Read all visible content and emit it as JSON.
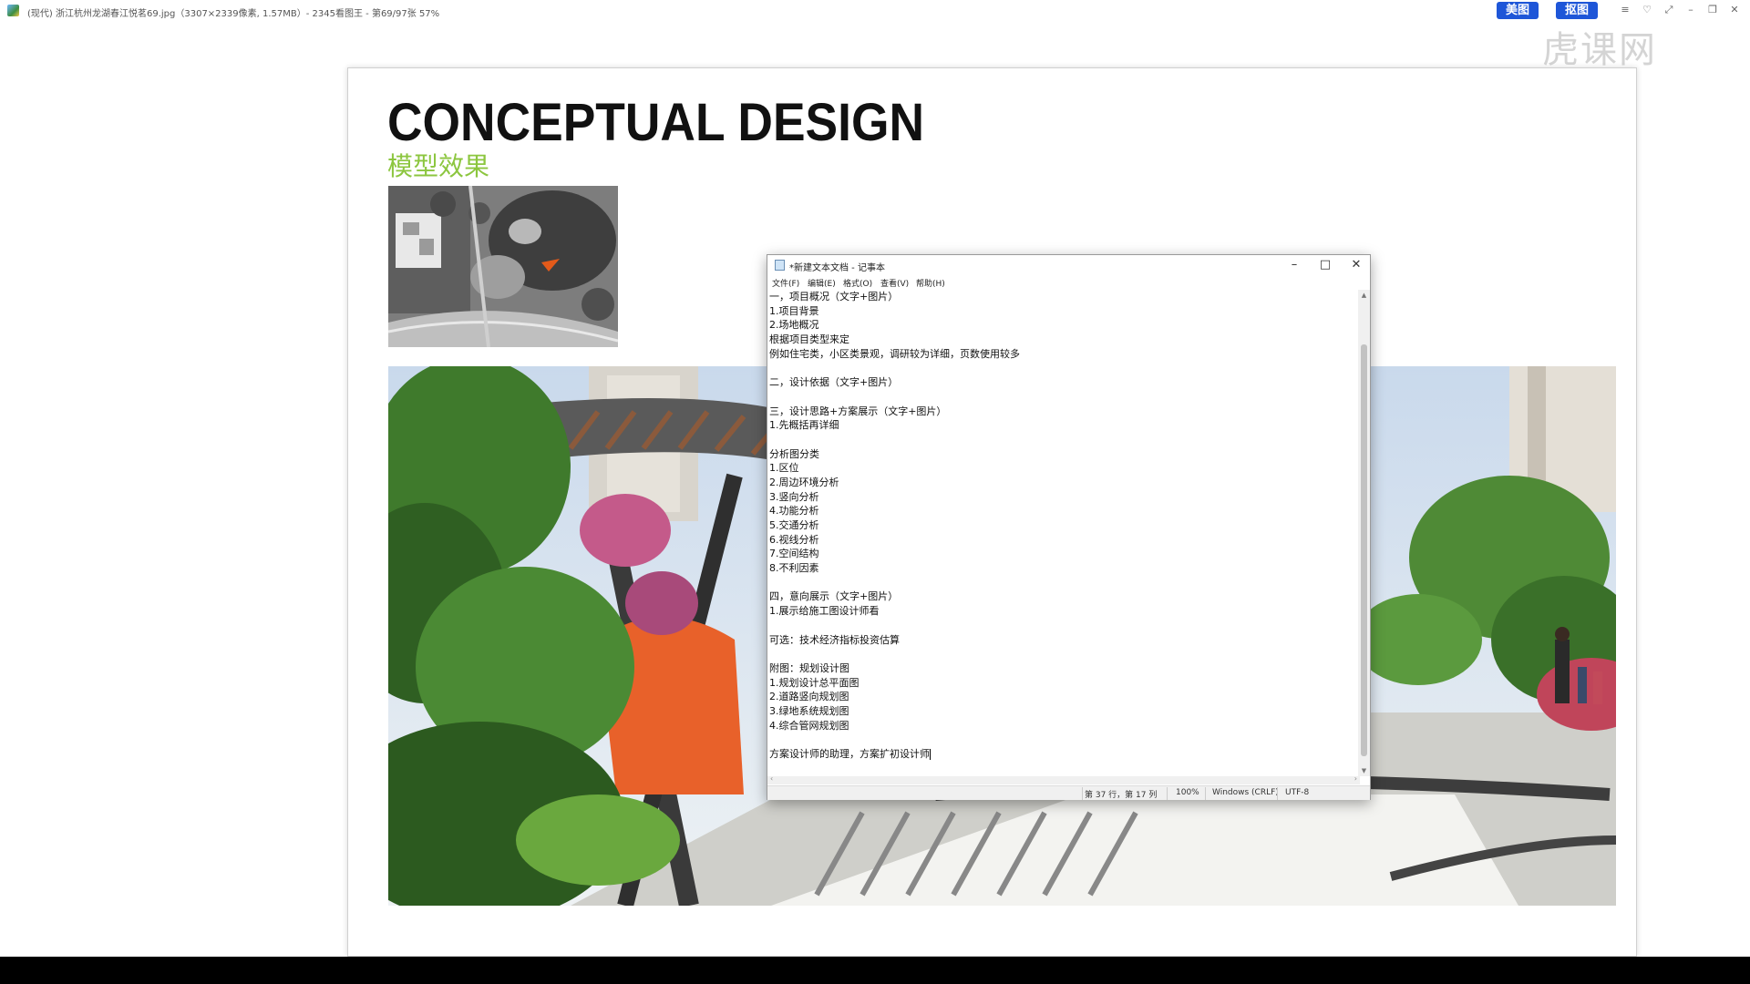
{
  "viewer": {
    "title": "(现代) 浙江杭州龙湖春江悦茗69.jpg（3307×2339像素, 1.57MB）- 2345看图王 - 第69/97张 57%",
    "btn_meitu": "美图",
    "btn_koutu": "抠图",
    "watermark": "虎课网",
    "controls": [
      "≡",
      "♡",
      "⤢",
      "–",
      "❐",
      "✕"
    ]
  },
  "document": {
    "title": "CONCEPTUAL DESIGN",
    "subtitle": "模型效果"
  },
  "notepad": {
    "title": "*新建文本文档 - 记事本",
    "controls": {
      "minimize": "–",
      "maximize": "□",
      "close": "✕"
    },
    "menu": [
      "文件(F)",
      "编辑(E)",
      "格式(O)",
      "查看(V)",
      "帮助(H)"
    ],
    "lines": [
      "一，项目概况（文字+图片）",
      "1.项目背景",
      "2.场地概况",
      "根据项目类型来定",
      "例如住宅类，小区类景观，调研较为详细，页数使用较多",
      "",
      "二，设计依据（文字+图片）",
      "",
      "三，设计思路+方案展示（文字+图片）",
      "1.先概括再详细",
      "",
      "分析图分类",
      "1.区位",
      "2.周边环境分析",
      "3.竖向分析",
      "4.功能分析",
      "5.交通分析",
      "6.视线分析",
      "7.空间结构",
      "8.不利因素",
      "",
      "四，意向展示（文字+图片）",
      "1.展示给施工图设计师看",
      "",
      "可选：技术经济指标投资估算",
      "",
      "附图：规划设计图",
      "1.规划设计总平面图",
      "2.道路竖向规划图",
      "3.绿地系统规划图",
      "4.综合管网规划图",
      "",
      "方案设计师的助理，方案扩初设计师"
    ],
    "status": {
      "position": "第 37 行，第 17 列",
      "zoom": "100%",
      "eol": "Windows (CRLF)",
      "encoding": "UTF-8"
    }
  }
}
